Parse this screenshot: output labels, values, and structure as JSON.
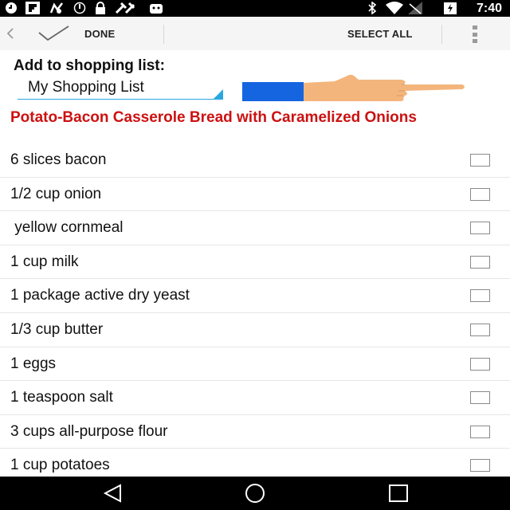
{
  "status_bar": {
    "time": "7:40",
    "left_icons": [
      "clock-icon",
      "flipboard-icon",
      "maps-icon",
      "sync-icon",
      "lock-icon",
      "tools-icon",
      "android-icon"
    ],
    "right_icons": [
      "bluetooth-icon",
      "wifi-icon",
      "signal-icon",
      "battery-icon"
    ]
  },
  "action_bar": {
    "done_label": "DONE",
    "select_all_label": "SELECT ALL"
  },
  "shopping": {
    "add_label": "Add to shopping list:",
    "selected_list": "My Shopping List"
  },
  "recipe": {
    "title": "Potato-Bacon Casserole Bread with Caramelized Onions",
    "title_color": "#cc1111"
  },
  "ingredients": [
    {
      "text": "6 slices bacon",
      "checked": false
    },
    {
      "text": "1/2 cup onion",
      "checked": false
    },
    {
      "text": " yellow cornmeal",
      "checked": false
    },
    {
      "text": "1 cup milk",
      "checked": false
    },
    {
      "text": "1 package active dry yeast",
      "checked": false
    },
    {
      "text": "1/3 cup butter",
      "checked": false
    },
    {
      "text": "1 eggs",
      "checked": false
    },
    {
      "text": "1 teaspoon salt",
      "checked": false
    },
    {
      "text": "3 cups all-purpose flour",
      "checked": false
    },
    {
      "text": "1 cup potatoes",
      "checked": false
    }
  ],
  "nav_bar": {
    "buttons": [
      "back-icon",
      "home-icon",
      "recents-icon"
    ]
  },
  "colors": {
    "accent": "#2aa7e0",
    "sleeve": "#1565e0",
    "hand": "#f3b57c"
  }
}
